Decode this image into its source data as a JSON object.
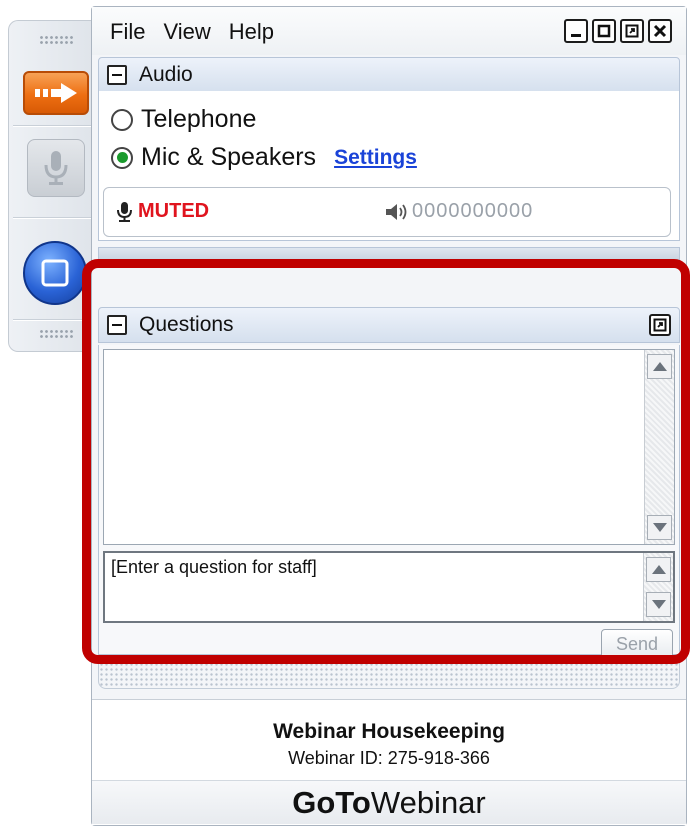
{
  "menu": {
    "items": [
      "File",
      "View",
      "Help"
    ]
  },
  "window_controls": [
    "minimize",
    "maximize",
    "restore",
    "close"
  ],
  "audio": {
    "header": "Audio",
    "options": [
      {
        "label": "Telephone",
        "selected": false
      },
      {
        "label": "Mic & Speakers",
        "selected": true
      }
    ],
    "settings_link": "Settings",
    "status": "MUTED",
    "volume_level": "0000000000"
  },
  "questions": {
    "header": "Questions",
    "input_placeholder": "[Enter a question for staff]",
    "send_label": "Send"
  },
  "footer": {
    "title": "Webinar Housekeeping",
    "webinar_id": "Webinar ID: 275-918-366",
    "brand_strong": "GoTo",
    "brand_light": "Webinar"
  },
  "colors": {
    "highlight": "#c00000",
    "muted": "#e0141e",
    "link": "#1a43d8",
    "accent_orange": "#ee6f12",
    "accent_blue": "#2a63d6"
  },
  "icons": [
    "arrow-icon",
    "microphone-icon",
    "screen-icon",
    "speaker-icon"
  ]
}
